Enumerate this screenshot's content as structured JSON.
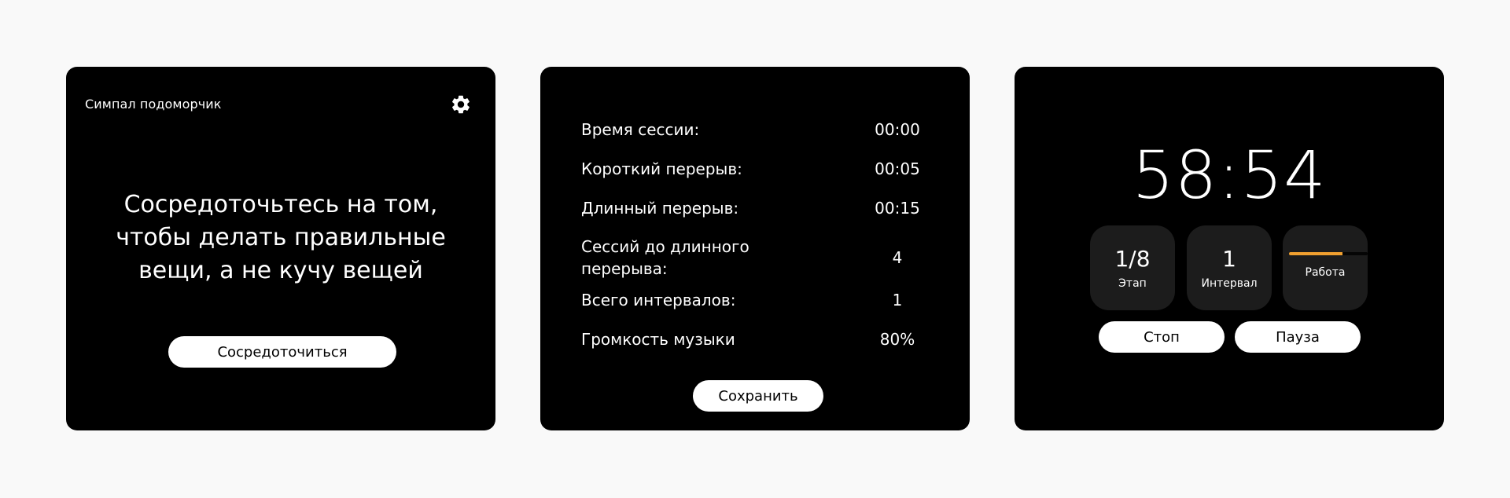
{
  "start_screen": {
    "app_title": "Симпал подоморчик",
    "settings_icon": "gear-icon",
    "quote": "Сосредоточьтесь на том, чтобы делать правильные вещи, а не кучу вещей",
    "focus_button": "Сосредоточиться"
  },
  "settings_screen": {
    "rows": [
      {
        "label": "Время сессии:",
        "value": "00:00"
      },
      {
        "label": "Короткий перерыв:",
        "value": "00:05"
      },
      {
        "label": "Длинный перерыв:",
        "value": "00:15"
      },
      {
        "label": "Сессий до длинного перерыва:",
        "value": "4"
      },
      {
        "label": "Всего интервалов:",
        "value": "1"
      },
      {
        "label": "Громкость музыки",
        "value": "80%"
      }
    ],
    "save_button": "Сохранить"
  },
  "timer_screen": {
    "time": "58:54",
    "stage": {
      "value": "1/8",
      "label": "Этап"
    },
    "interval": {
      "value": "1",
      "label": "Интервал"
    },
    "phase": {
      "label": "Работа",
      "progress": 0.68
    },
    "stop_button": "Стоп",
    "pause_button": "Пауза",
    "accent_color": "#f0a030"
  }
}
